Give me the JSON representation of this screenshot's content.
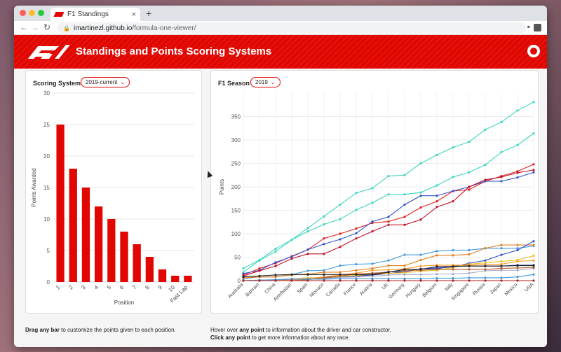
{
  "browser": {
    "tab_title": "F1 Standings",
    "tab_close": "×",
    "new_tab": "+",
    "url_host": "imartinezl.github.io",
    "url_path": "/formula-one-viewer/"
  },
  "header": {
    "title": "Standings and Points Scoring Systems"
  },
  "left_panel": {
    "label": "Scoring System",
    "select_value": "2019-current",
    "hint_bold": "Drag any bar",
    "hint_rest": " to customize the points given to each position."
  },
  "right_panel": {
    "label": "F1 Season",
    "select_value": "2019",
    "hint1_prefix": "Hover over ",
    "hint1_bold": "any point",
    "hint1_rest": " to information about the driver and car constructor.",
    "hint2_bold": "Click any point",
    "hint2_rest": " to get more information about any race."
  },
  "colors": {
    "accent": "#e10600"
  },
  "chart_data": [
    {
      "type": "bar",
      "categories": [
        "1",
        "2",
        "3",
        "4",
        "5",
        "6",
        "7",
        "8",
        "9",
        "10",
        "Fast Lap"
      ],
      "values": [
        25,
        18,
        15,
        12,
        10,
        8,
        6,
        4,
        2,
        1,
        1
      ],
      "title": "",
      "xlabel": "Position",
      "ylabel": "Points Awarded",
      "ylim": [
        0,
        30
      ],
      "yticks": [
        0,
        5,
        10,
        15,
        20,
        25,
        30
      ],
      "color": "#e10600"
    },
    {
      "type": "line",
      "title": "",
      "xlabel": "",
      "ylabel": "Points",
      "ylim": [
        0,
        400
      ],
      "yticks": [
        0,
        50,
        100,
        150,
        200,
        250,
        300,
        350
      ],
      "categories": [
        "Australia",
        "Bahrain",
        "China",
        "Azerbaijan",
        "Spain",
        "Monaco",
        "Canada",
        "France",
        "Austria",
        "UK",
        "Germany",
        "Hungary",
        "Belgium",
        "Italy",
        "Singapore",
        "Russia",
        "Japan",
        "Mexico",
        "USA"
      ],
      "series": [
        {
          "color": "#3fd6c0",
          "values": [
            26,
            44,
            68,
            87,
            112,
            137,
            162,
            187,
            197,
            223,
            225,
            250,
            268,
            284,
            296,
            322,
            338,
            363,
            381
          ]
        },
        {
          "color": "#3fd6c0",
          "values": [
            18,
            43,
            62,
            87,
            105,
            120,
            131,
            151,
            166,
            184,
            184,
            188,
            203,
            221,
            231,
            247,
            274,
            289,
            314
          ]
        },
        {
          "color": "#e02020",
          "values": [
            12,
            26,
            37,
            52,
            66,
            90,
            100,
            111,
            123,
            126,
            136,
            156,
            169,
            191,
            194,
            212,
            223,
            233,
            248
          ]
        },
        {
          "color": "#3355cc",
          "values": [
            15,
            22,
            39,
            51,
            66,
            78,
            88,
            101,
            126,
            136,
            162,
            181,
            181,
            191,
            200,
            212,
            212,
            220,
            231
          ]
        },
        {
          "color": "#c0102a",
          "values": [
            10,
            21,
            31,
            47,
            57,
            57,
            72,
            90,
            105,
            119,
            119,
            130,
            157,
            169,
            200,
            215,
            221,
            230,
            236
          ]
        },
        {
          "color": "#4499dd",
          "values": [
            4,
            8,
            8,
            13,
            21,
            22,
            32,
            35,
            36,
            43,
            55,
            55,
            63,
            65,
            65,
            69,
            69,
            69,
            74
          ]
        },
        {
          "color": "#e08020",
          "values": [
            6,
            8,
            8,
            12,
            14,
            18,
            18,
            22,
            26,
            32,
            32,
            44,
            54,
            54,
            56,
            69,
            76,
            76,
            76
          ]
        },
        {
          "color": "#3355cc",
          "values": [
            0,
            0,
            2,
            4,
            4,
            8,
            9,
            9,
            14,
            19,
            19,
            25,
            27,
            29,
            37,
            43,
            55,
            65,
            84
          ]
        },
        {
          "color": "#3a3aa0",
          "values": [
            0,
            0,
            0,
            2,
            4,
            6,
            8,
            10,
            12,
            15,
            19,
            25,
            25,
            31,
            31,
            31,
            31,
            33,
            33
          ]
        },
        {
          "color": "#f0c020",
          "values": [
            0,
            1,
            2,
            4,
            6,
            6,
            9,
            11,
            14,
            15,
            17,
            20,
            22,
            28,
            35,
            38,
            41,
            44,
            53
          ]
        },
        {
          "color": "#ff9922",
          "values": [
            0,
            0,
            0,
            2,
            3,
            8,
            12,
            16,
            22,
            23,
            25,
            31,
            33,
            33,
            33,
            35,
            35,
            41,
            43
          ]
        },
        {
          "color": "#aaaacc",
          "values": [
            0,
            1,
            1,
            4,
            4,
            4,
            7,
            8,
            9,
            12,
            13,
            13,
            14,
            14,
            16,
            21,
            22,
            22,
            26
          ]
        },
        {
          "color": "#b06030",
          "values": [
            0,
            0,
            0,
            0,
            2,
            6,
            10,
            14,
            16,
            18,
            22,
            22,
            24,
            24,
            24,
            24,
            26,
            27,
            28
          ]
        },
        {
          "color": "#222222",
          "values": [
            8,
            10,
            12,
            13,
            13,
            13,
            13,
            13,
            13,
            18,
            24,
            24,
            30,
            30,
            31,
            31,
            31,
            32,
            32
          ]
        },
        {
          "color": "#4499dd",
          "values": [
            0,
            1,
            2,
            3,
            3,
            3,
            4,
            4,
            4,
            4,
            4,
            4,
            5,
            5,
            6,
            6,
            6,
            8,
            13
          ]
        },
        {
          "color": "#aa2222",
          "values": [
            0,
            0,
            0,
            0,
            0,
            0,
            0,
            0,
            0,
            0,
            0,
            0,
            0,
            0,
            0,
            0,
            0,
            0,
            0
          ]
        }
      ]
    }
  ]
}
